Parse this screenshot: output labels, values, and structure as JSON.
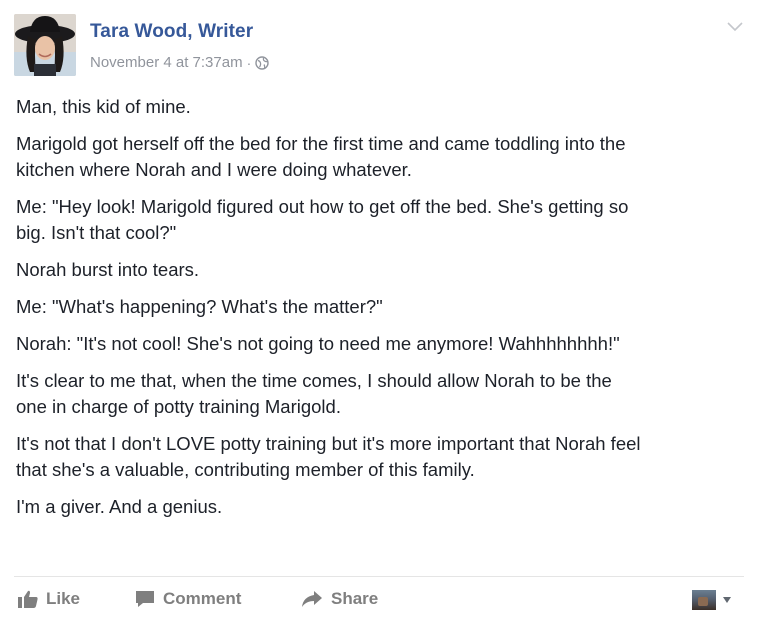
{
  "post": {
    "author": "Tara Wood, Writer",
    "timestamp": "November 4 at 7:37am",
    "separator": "·",
    "privacy_icon": "globe-icon",
    "menu_icon": "chevron-down-icon",
    "paragraphs": [
      "Man, this kid of mine.",
      "Marigold got herself off the bed for the first time and came toddling into the\nkitchen where Norah and I were doing whatever.",
      "Me: \"Hey look! Marigold figured out how to get off the bed. She's getting so\nbig. Isn't that cool?\"",
      "Norah burst into tears.",
      "Me: \"What's happening? What's the matter?\"",
      "Norah: \"It's not cool! She's not going to need me anymore! Wahhhhhhhh!\"",
      "It's clear to me that, when the time comes, I should allow Norah to be the\none in charge of potty training Marigold.",
      "It's not that I don't LOVE potty training but it's more important that Norah feel\nthat she's a valuable, contributing member of this family.",
      "I'm a giver. And a genius."
    ]
  },
  "actions": {
    "like_label": "Like",
    "comment_label": "Comment",
    "share_label": "Share"
  },
  "colors": {
    "author": "#365899",
    "meta": "#90949c",
    "text": "#1d2129",
    "action": "#7f7f7f"
  }
}
